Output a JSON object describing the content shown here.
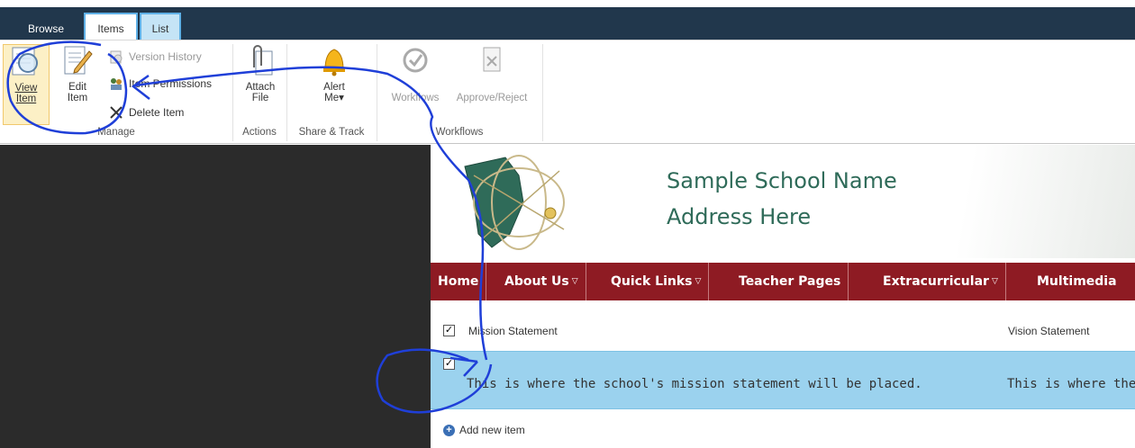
{
  "ribbon_tabs": {
    "browse": "Browse",
    "items": "Items",
    "list": "List"
  },
  "manage": {
    "view_item": [
      "View",
      "Item"
    ],
    "edit_item": [
      "Edit",
      "Item"
    ],
    "version_history": "Version History",
    "item_permissions": "Item Permissions",
    "delete_item": "Delete Item",
    "group_label": "Manage"
  },
  "actions": {
    "attach_file": [
      "Attach",
      "File"
    ],
    "group_label": "Actions"
  },
  "share_track": {
    "alert_me": [
      "Alert",
      "Me"
    ],
    "group_label": "Share & Track"
  },
  "workflows": {
    "workflows": "Workflows",
    "approve_reject": "Approve/Reject",
    "group_label": "Workflows"
  },
  "site": {
    "title_line1": "Sample School Name",
    "title_line2": "Address Here"
  },
  "nav": [
    {
      "label": "Home",
      "has_menu": false
    },
    {
      "label": "About Us",
      "has_menu": true
    },
    {
      "label": "Quick Links",
      "has_menu": true
    },
    {
      "label": "Teacher Pages",
      "has_menu": false
    },
    {
      "label": "Extracurricular",
      "has_menu": true
    },
    {
      "label": "Multimedia",
      "has_menu": false
    }
  ],
  "list": {
    "columns": [
      "Mission Statement",
      "Vision Statement"
    ],
    "rows": [
      {
        "mission": "This is where the school's mission statement will be placed.",
        "vision": "This is where the"
      }
    ],
    "add_new": "Add new item"
  },
  "colors": {
    "nav_bg": "#8e1b23",
    "selected_row": "#9bd2ee",
    "annotation": "#1f3fd8",
    "title": "#2f6b59"
  }
}
